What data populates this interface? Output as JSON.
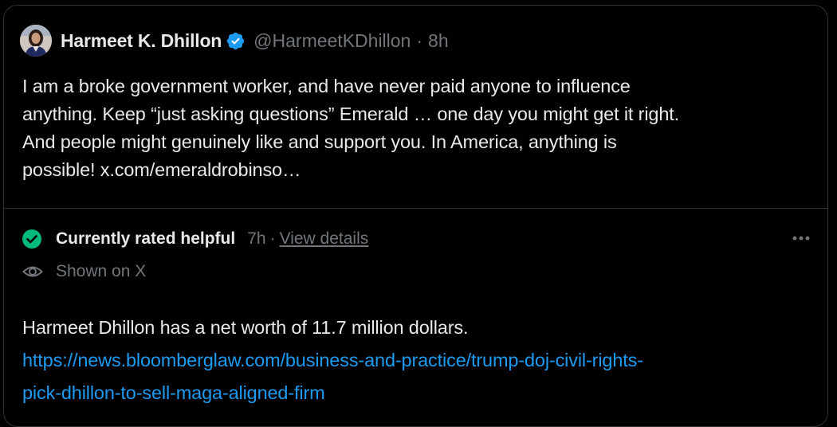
{
  "tweet": {
    "author_name": "Harmeet K. Dhillon",
    "handle": "@HarmeetKDhillon",
    "separator": "·",
    "time": "8h",
    "text_lines": [
      "I am a broke government worker, and have never paid anyone to influence",
      "anything. Keep “just asking questions” Emerald … one day you might get it right.",
      "And people might genuinely like and support you. In America, anything is",
      "possible! x.com/emeraldrobinso…"
    ]
  },
  "community_note": {
    "status_label": "Currently rated helpful",
    "status_time": "7h",
    "separator": "·",
    "view_details_label": "View details",
    "shown_label": "Shown on X",
    "note_text": "Harmeet Dhillon has a net worth of 11.7 million dollars.",
    "link_lines": [
      "https://news.bloomberglaw.com/business-and-practice/trump-doj-civil-rights-",
      "pick-dhillon-to-sell-maga-aligned-firm"
    ]
  },
  "icons": {
    "verified": "verified-badge-icon",
    "check": "check-circle-icon",
    "eye": "eye-icon",
    "more": "more-horizontal-icon"
  },
  "colors": {
    "background": "#000000",
    "text_primary": "#e7e9ea",
    "text_secondary": "#71767b",
    "link": "#1d9bf0",
    "verified_blue": "#1d9bf0",
    "helpful_green": "#00ba7c",
    "border": "#2f3336"
  }
}
